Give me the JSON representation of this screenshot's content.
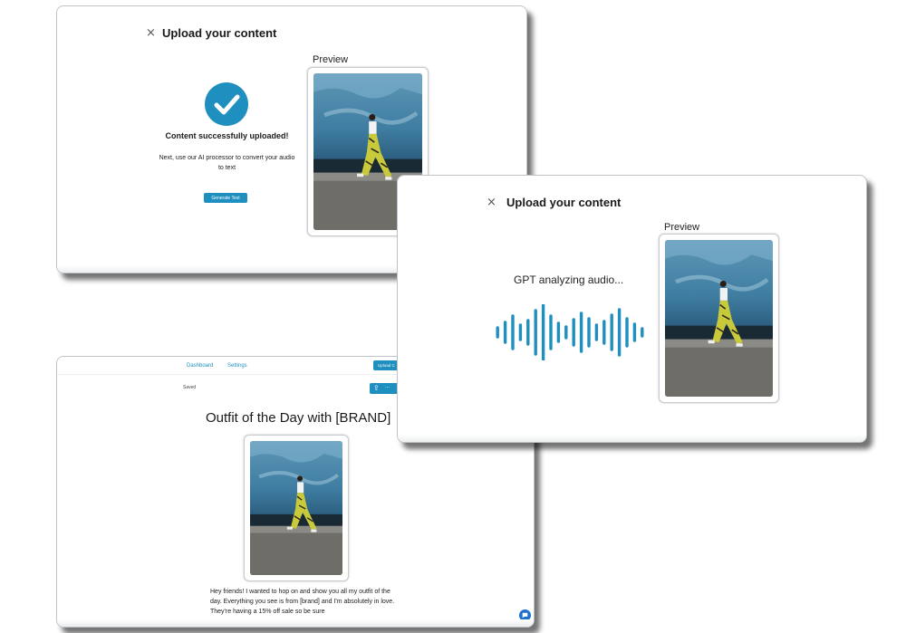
{
  "colors": {
    "accent": "#1f8fbf",
    "chat_accent": "#1f6fd1",
    "panel_border": "#bfc3c8"
  },
  "icons": {
    "close": "×",
    "success": "check-icon",
    "share": "share-icon",
    "chat": "chat-icon"
  },
  "upload_success_modal": {
    "close_label": "×",
    "title": "Upload your content",
    "preview_label": "Preview",
    "success_title": "Content successfully uploaded!",
    "success_message": "Next, use our AI processor to convert your audio to text",
    "generate_button_label": "Generate Text"
  },
  "analyzing_modal": {
    "close_label": "×",
    "title": "Upload your content",
    "preview_label": "Preview",
    "status_text": "GPT analyzing audio..."
  },
  "editor": {
    "nav": {
      "dashboard_label": "Dashboard",
      "settings_label": "Settings",
      "upload_button_label": "Upload C"
    },
    "saved_label": "Saved",
    "share_more_label": "...",
    "post_title": "Outfit of the Day with [BRAND]",
    "post_body": "Hey friends! I wanted to hop on and show you all my outfit of the day. Everything you see is from [brand] and I'm absolutely in love. They're having a 15% off sale so be sure"
  }
}
